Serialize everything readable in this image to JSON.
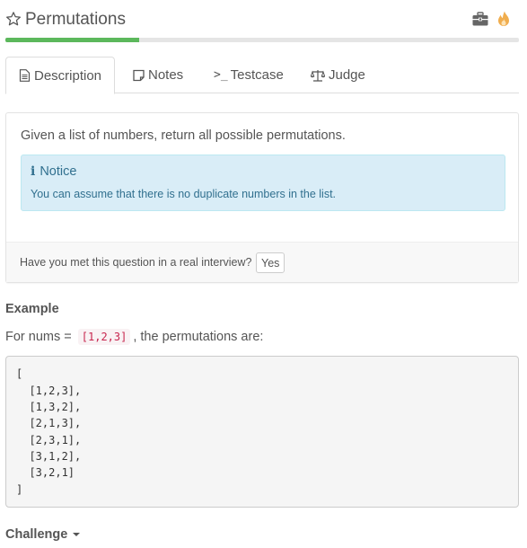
{
  "header": {
    "title": "Permutations",
    "icons": {
      "favorite": "star-icon",
      "toolbox": "briefcase-icon",
      "hot": "flame-icon"
    }
  },
  "progress": {
    "percent": 26,
    "color": "#5cb85c"
  },
  "tabs": [
    {
      "label": "Description",
      "icon": "document-icon",
      "active": true
    },
    {
      "label": "Notes",
      "icon": "note-icon",
      "active": false
    },
    {
      "label": "Testcase",
      "icon": "terminal-icon",
      "active": false
    },
    {
      "label": "Judge",
      "icon": "balance-scale-icon",
      "active": false
    }
  ],
  "problem": {
    "description": "Given a list of numbers, return all possible permutations.",
    "notice": {
      "title": "Notice",
      "text": "You can assume that there is no duplicate numbers in the list."
    },
    "interview_question": "Have you met this question in a real interview?",
    "interview_button": "Yes"
  },
  "example": {
    "title": "Example",
    "prefix": "For nums = ",
    "nums": "[1,2,3]",
    "suffix": ", the permutations are:",
    "output_lines": [
      "[",
      "  [1,2,3],",
      "  [1,3,2],",
      "  [2,1,3],",
      "  [2,3,1],",
      "  [3,1,2],",
      "  [3,2,1]",
      "]"
    ]
  },
  "challenge": {
    "label": "Challenge"
  },
  "colors": {
    "accent_green": "#5cb85c",
    "info_bg": "#d9edf7",
    "info_text": "#31708f",
    "code_text": "#c7254e",
    "flame": "#f0ad4e"
  }
}
